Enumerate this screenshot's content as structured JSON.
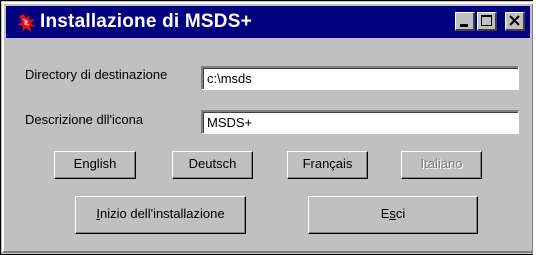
{
  "window": {
    "title": "Installazione di MSDS+",
    "app_icon": "dragon-app-icon",
    "controls": [
      "minimize-icon",
      "maximize-icon",
      "close-icon"
    ]
  },
  "form": {
    "destination_label": "Directory di destinazione",
    "destination_value": "c:\\msds",
    "icon_desc_label": "Descrizione dll'icona",
    "icon_desc_value": "MSDS+"
  },
  "languages": [
    {
      "label": "English",
      "enabled": true
    },
    {
      "label": "Deutsch",
      "enabled": true
    },
    {
      "label": "Français",
      "enabled": true
    },
    {
      "label": "Italiano",
      "enabled": false
    }
  ],
  "actions": {
    "install_label": "Inizio dell'installazione",
    "install_mnemonic": "I",
    "exit_label": "Esci",
    "exit_mnemonic": "s"
  },
  "colors": {
    "titlebar": "#000080",
    "face": "#c0c0c0"
  }
}
